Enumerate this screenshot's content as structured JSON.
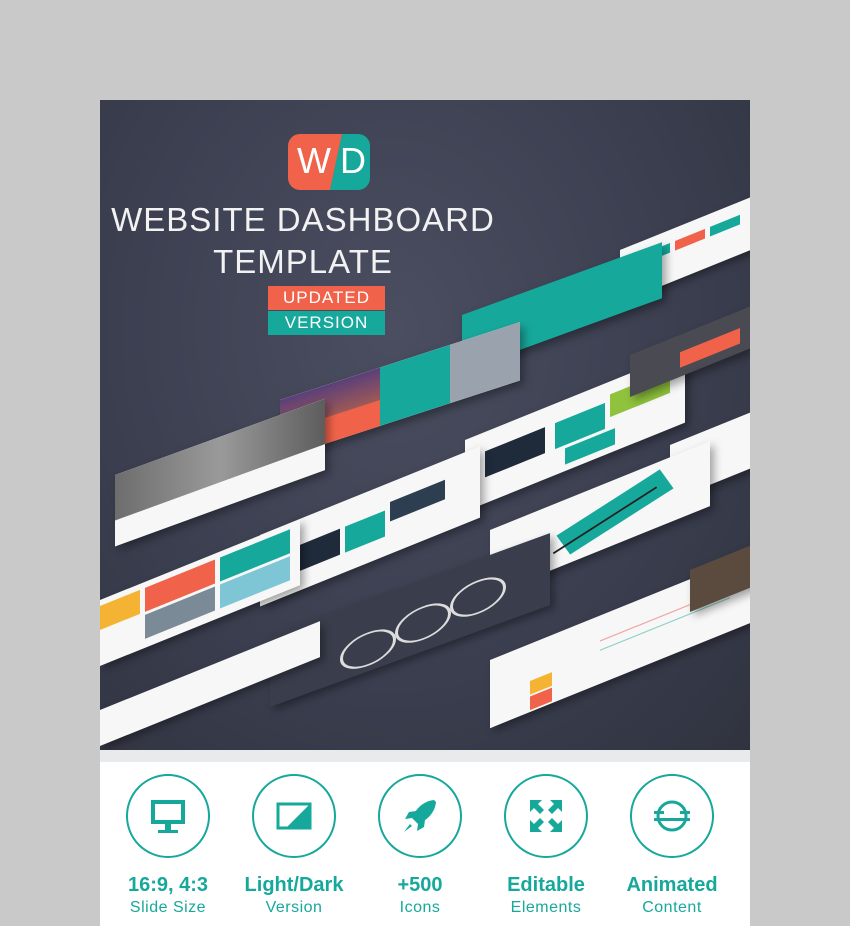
{
  "header": {
    "logo_text_left": "W",
    "logo_text_right": "D",
    "title_line1": "WEBSITE DASHBOARD",
    "title_line2": "TEMPLATE",
    "badge_updated": "UPDATED",
    "badge_version": "VERSION"
  },
  "colors": {
    "accent_orange": "#f0634a",
    "accent_teal": "#17a89c",
    "hero_background": "#3b3f50"
  },
  "features": [
    {
      "icon": "monitor-icon",
      "title": "16:9, 4:3",
      "subtitle": "Slide Size"
    },
    {
      "icon": "light-dark-icon",
      "title": "Light/Dark",
      "subtitle": "Version"
    },
    {
      "icon": "rocket-icon",
      "title": "+500",
      "subtitle": "Icons"
    },
    {
      "icon": "expand-arrows-icon",
      "title": "Editable",
      "subtitle": "Elements"
    },
    {
      "icon": "animated-globe-icon",
      "title": "Animated",
      "subtitle": "Content"
    }
  ]
}
